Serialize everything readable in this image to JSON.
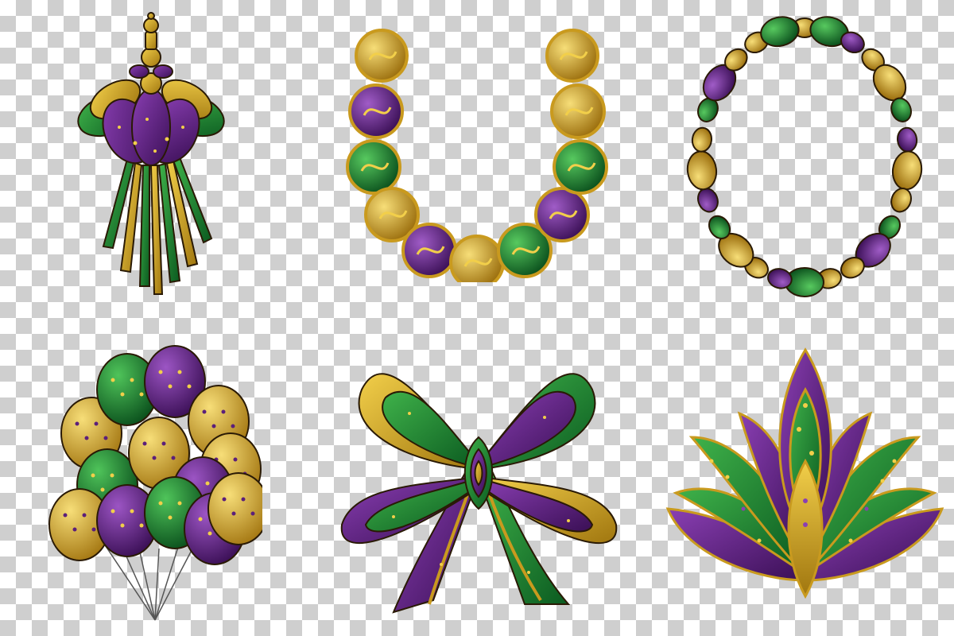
{
  "palette": {
    "purple": "#5b1f7a",
    "purple_light": "#8a3fb3",
    "green": "#127a2f",
    "green_light": "#3fb24a",
    "gold": "#c99a1e",
    "gold_light": "#f2cf4a",
    "outline": "#2a1a05",
    "checker_light": "#ffffff",
    "checker_dark": "#cfcfcf"
  },
  "items": [
    {
      "name": "tassel-ornament",
      "colors": [
        "purple",
        "green",
        "gold"
      ]
    },
    {
      "name": "bead-horseshoe",
      "colors": [
        "purple",
        "green",
        "gold"
      ]
    },
    {
      "name": "bead-necklace",
      "colors": [
        "purple",
        "green",
        "gold"
      ]
    },
    {
      "name": "balloon-bunch",
      "colors": [
        "purple",
        "green",
        "gold"
      ]
    },
    {
      "name": "ribbon-bow",
      "colors": [
        "purple",
        "green",
        "gold"
      ]
    },
    {
      "name": "lotus-mask",
      "colors": [
        "purple",
        "green",
        "gold"
      ]
    }
  ]
}
